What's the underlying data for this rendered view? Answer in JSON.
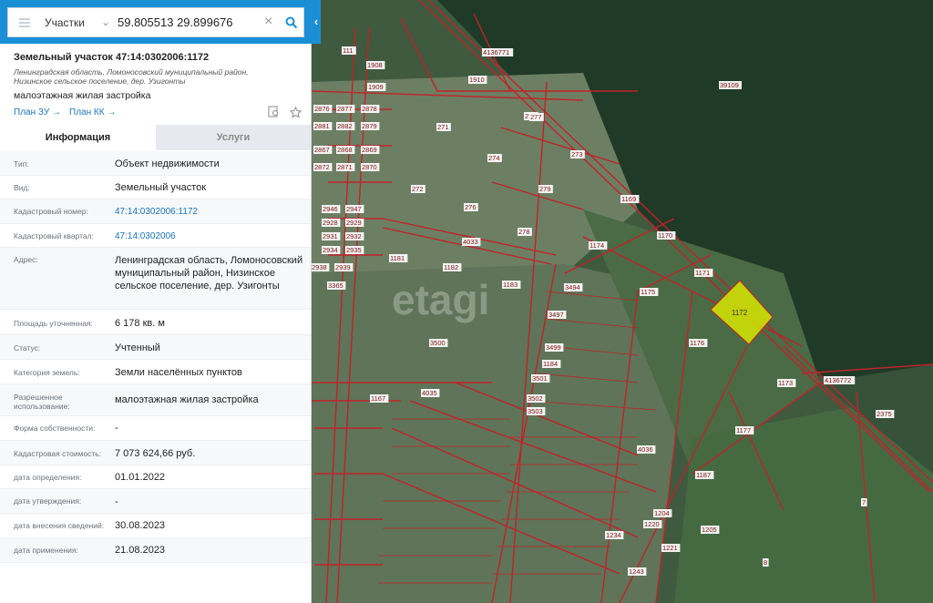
{
  "search": {
    "category": "Участки",
    "query": "59.805513 29.899676"
  },
  "object": {
    "title": "Земельный участок 47:14:0302006:1172",
    "address_short": "Ленинградская область, Ломоносовский муниципальный район, Низинское сельское поселение, дер. Узигонты",
    "use": "малоэтажная жилая застройка",
    "link_plan_zu": "План ЗУ →",
    "link_plan_kk": "План КК →"
  },
  "tabs": {
    "info": "Информация",
    "services": "Услуги"
  },
  "fields": [
    {
      "label": "Тип:",
      "value": "Объект недвижимости"
    },
    {
      "label": "Вид:",
      "value": "Земельный участок"
    },
    {
      "label": "Кадастровый номер:",
      "value": "47:14:0302006:1172"
    },
    {
      "label": "Кадастровый квартал:",
      "value": "47:14:0302006"
    },
    {
      "label": "Адрес:",
      "value": "Ленинградская область, Ломоносовский муниципальный район, Низинское сельское поселение, дер. Узигонты"
    },
    {
      "label": "Площадь уточненная:",
      "value": "6 178 кв. м"
    },
    {
      "label": "Статус:",
      "value": "Учтенный"
    },
    {
      "label": "Категория земель:",
      "value": "Земли населённых пунктов"
    },
    {
      "label": "Разрешенное использование:",
      "value": "малоэтажная жилая застройка"
    },
    {
      "label": "Форма собственности:",
      "value": "-"
    },
    {
      "label": "Кадастровая стоимость:",
      "value": "7 073 624,66 руб."
    },
    {
      "label": "дата определения:",
      "value": "01.01.2022"
    },
    {
      "label": "дата утверждения:",
      "value": "-"
    },
    {
      "label": "дата внесения сведений:",
      "value": "30.08.2023"
    },
    {
      "label": "дата применения:",
      "value": "21.08.2023"
    }
  ],
  "map": {
    "watermark": "etagi",
    "highlight_label": "1172",
    "parcel_labels": [
      "111",
      "1908",
      "1909",
      "1910",
      "275",
      "277",
      "39109",
      "4136771",
      "2876",
      "2877",
      "2878",
      "2881",
      "2882",
      "2879",
      "271",
      "2867",
      "2868",
      "2869",
      "2872",
      "2871",
      "2870",
      "273",
      "274",
      "279",
      "272",
      "276",
      "1169",
      "2946",
      "2947",
      "2928",
      "2929",
      "2931",
      "2932",
      "2934",
      "2935",
      "2938",
      "2939",
      "278",
      "1170",
      "4033",
      "1174",
      "1181",
      "1182",
      "1171",
      "3365",
      "1183",
      "3494",
      "3497",
      "1175",
      "1176",
      "3499",
      "3500",
      "1184",
      "3501",
      "3502",
      "3503",
      "4035",
      "1173",
      "1177",
      "4136772",
      "2375",
      "1187",
      "1167",
      "1205",
      "1220",
      "1221",
      "1234",
      "1204",
      "1243",
      "7",
      "8",
      "4036"
    ]
  },
  "colors": {
    "accent": "#1a8fd6",
    "link": "#1a73b8",
    "highlight": "#d4e600",
    "parcel_line": "#c0232a"
  }
}
